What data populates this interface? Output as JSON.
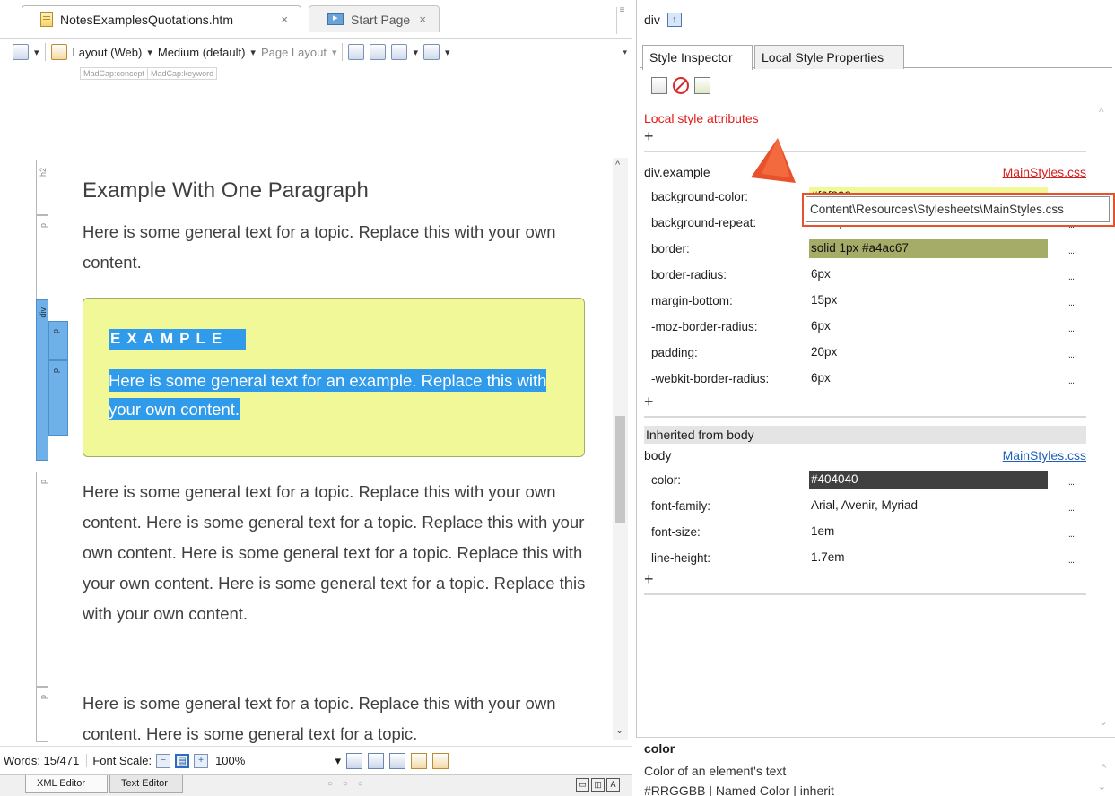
{
  "editor": {
    "tabs": [
      {
        "label": "NotesExamplesQuotations.htm",
        "close": "×"
      },
      {
        "label": "Start Page",
        "close": "×"
      }
    ],
    "toolbar": {
      "layout": "Layout (Web)",
      "medium": "Medium (default)",
      "page_layout": "Page Layout"
    },
    "concept_tags": [
      "MadCap:concept",
      "MadCap:keyword"
    ],
    "structure_tags": {
      "h2": "h2",
      "p": "p",
      "div": "div"
    },
    "content": {
      "heading": "Example With One Paragraph",
      "p1": "Here is some general text for a topic. Replace this with your own content.",
      "example_heading": "EXAMPLE",
      "example_text": "Here is some general text for an example. Replace this with your own content.",
      "p2": "Here is some general text for a topic. Replace this with your own content. Here is some general text for a topic. Replace this with your own content. Here is some general text for a topic. Replace this with your own content. Here is some general text for a topic. Replace this with your own content.",
      "p3": "Here is some general text for a topic. Replace this with your own content. Here is some general text for a topic."
    },
    "status": {
      "words": "Words: 15/471",
      "font_scale": "Font Scale:",
      "zoom": "100%"
    },
    "bottom_tabs": [
      "XML Editor",
      "Text Editor"
    ],
    "grip": "○ ○ ○"
  },
  "inspector": {
    "selected_element": "div",
    "tabs": [
      "Style Inspector",
      "Local Style Properties"
    ],
    "local_title": "Local style attributes",
    "plus": "+",
    "rule1": {
      "selector": "div.example",
      "source": "MainStyles.css",
      "properties": [
        {
          "name": "background-color:",
          "value": "#f0f898"
        },
        {
          "name": "background-repeat:",
          "value": "no-repeat"
        },
        {
          "name": "border:",
          "value": "solid 1px #a4ac67"
        },
        {
          "name": "border-radius:",
          "value": "6px"
        },
        {
          "name": "margin-bottom:",
          "value": "15px"
        },
        {
          "name": "-moz-border-radius:",
          "value": "6px"
        },
        {
          "name": "padding:",
          "value": "20px"
        },
        {
          "name": "-webkit-border-radius:",
          "value": "6px"
        }
      ]
    },
    "inherited_title": "Inherited from body",
    "rule2": {
      "selector": "body",
      "source": "MainStyles.css",
      "properties": [
        {
          "name": "color:",
          "value": "#404040"
        },
        {
          "name": "font-family:",
          "value": "Arial, Avenir, Myriad"
        },
        {
          "name": "font-size:",
          "value": "1em"
        },
        {
          "name": "line-height:",
          "value": "1.7em"
        }
      ]
    },
    "tooltip": "Content\\Resources\\Stylesheets\\MainStyles.css",
    "dots": "...",
    "description": {
      "name": "color",
      "text": "Color of an element's text",
      "values": "#RRGGBB | Named Color | inherit"
    }
  },
  "colors": {
    "example_bg": "#f0f898",
    "example_border": "#a4ac67",
    "selection": "#2f9bea",
    "body_text": "#404040",
    "link_red": "#d41e1e",
    "callout_orange": "#e8512b"
  }
}
